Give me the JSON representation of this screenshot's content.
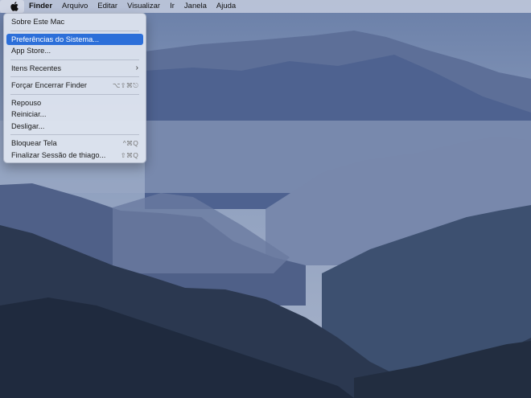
{
  "menubar": {
    "apple_icon": "apple-logo-icon",
    "app_name": "Finder",
    "menus": [
      "Arquivo",
      "Editar",
      "Visualizar",
      "Ir",
      "Janela",
      "Ajuda"
    ]
  },
  "apple_menu": {
    "about": "Sobre Este Mac",
    "system_prefs": "Preferências do Sistema...",
    "app_store": "App Store...",
    "recent_items": "Itens Recentes",
    "force_quit": "Forçar Encerrar Finder",
    "force_quit_shortcut": "⌥⇧⌘⎋",
    "sleep": "Repouso",
    "restart": "Reiniciar...",
    "shutdown": "Desligar...",
    "lock_screen": "Bloquear Tela",
    "lock_screen_shortcut": "^⌘Q",
    "logout": "Finalizar Sessão de thiago...",
    "logout_shortcut": "⇧⌘Q"
  },
  "colors": {
    "highlight": "#2c6fd9",
    "menu_bg": "#e2e8f2"
  }
}
